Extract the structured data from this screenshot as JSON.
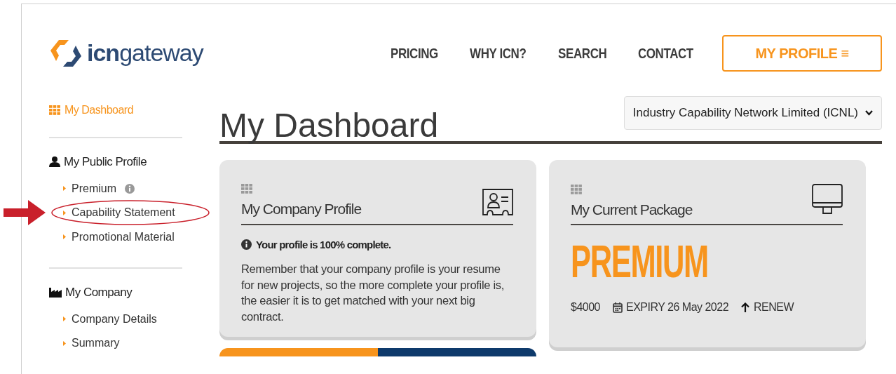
{
  "logo": {
    "text_bold": "icn",
    "text_light": "gateway"
  },
  "nav": {
    "links": [
      "PRICING",
      "WHY ICN?",
      "SEARCH",
      "CONTACT"
    ],
    "profile_button": "MY PROFILE ≡"
  },
  "sidebar": {
    "dashboard": {
      "label": "My Dashboard",
      "selected": true
    },
    "sections": [
      {
        "title": "My Public Profile",
        "items": [
          {
            "label": "Premium",
            "info": true,
            "annotated": false
          },
          {
            "label": "Capability Statement",
            "info": false,
            "annotated": true
          },
          {
            "label": "Promotional Material",
            "info": false,
            "annotated": false
          }
        ]
      },
      {
        "title": "My Company",
        "items": [
          {
            "label": "Company Details",
            "info": false,
            "annotated": false
          },
          {
            "label": "Summary",
            "info": false,
            "annotated": false
          }
        ]
      }
    ]
  },
  "page_title": "My Dashboard",
  "company_select": {
    "value": "Industry Capability Network Limited (ICNL)"
  },
  "cards": [
    {
      "kind": "profile",
      "title": "My Company Profile",
      "status": "Your profile is 100% complete.",
      "body": "Remember that your company profile is your resume for new projects, so the more complete your profile is, the easier it is to get matched with your next big contract."
    },
    {
      "kind": "package",
      "title": "My Current Package",
      "package": "PREMIUM",
      "price": "$4000",
      "expiry": "EXPIRY 26 May 2022",
      "renew": "RENEW"
    }
  ]
}
